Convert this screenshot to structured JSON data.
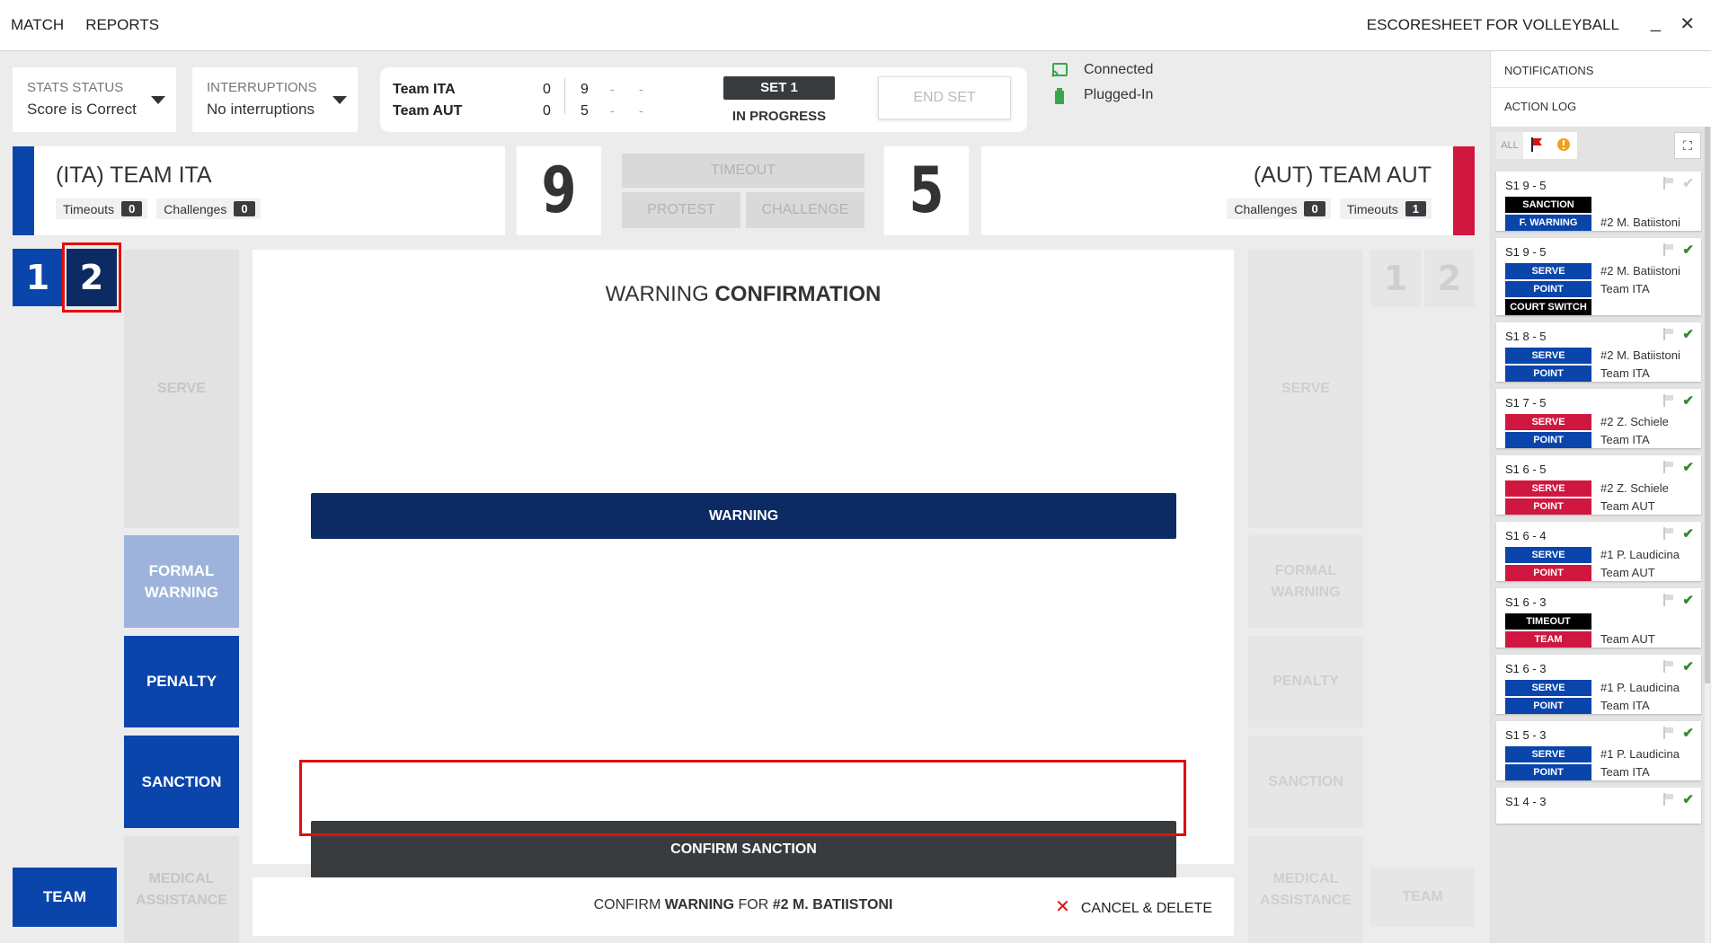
{
  "topbar": {
    "menu": [
      "MATCH",
      "REPORTS"
    ],
    "app_title": "ESCORESHEET FOR VOLLEYBALL",
    "minimize": "_",
    "close": "✕"
  },
  "stats_status": {
    "label": "STATS STATUS",
    "value": "Score is Correct"
  },
  "interruptions": {
    "label": "INTERRUPTIONS",
    "value": "No interruptions"
  },
  "scoreboard": {
    "team1": "Team ITA",
    "team1_sets": "0",
    "team1_points": "9",
    "team2": "Team AUT",
    "team2_sets": "0",
    "team2_points": "5",
    "dash": "-",
    "set_label": "SET 1",
    "set_state": "IN PROGRESS",
    "end_set": "END SET"
  },
  "connection": {
    "status": "Connected",
    "power": "Plugged-In"
  },
  "home": {
    "name": "(ITA) TEAM ITA",
    "timeouts_label": "Timeouts",
    "timeouts": "0",
    "challenges_label": "Challenges",
    "challenges": "0",
    "score": "9",
    "color": "#0a45ab"
  },
  "away": {
    "name": "(AUT) TEAM AUT",
    "timeouts_label": "Timeouts",
    "timeouts": "1",
    "challenges_label": "Challenges",
    "challenges": "0",
    "score": "5",
    "color": "#d0173f"
  },
  "middle_buttons": {
    "timeout": "TIMEOUT",
    "protest": "PROTEST",
    "challenge": "CHALLENGE"
  },
  "sets": {
    "set1": "1",
    "set2": "2"
  },
  "left_actions": {
    "serve": "SERVE",
    "formal_warning": "FORMAL WARNING",
    "penalty": "PENALTY",
    "sanction": "SANCTION",
    "medical": "MEDICAL ASSISTANCE",
    "team": "TEAM"
  },
  "right_actions": {
    "serve": "SERVE",
    "formal_warning": "FORMAL WARNING",
    "penalty": "PENALTY",
    "sanction": "SANCTION",
    "medical": "MEDICAL ASSISTANCE",
    "team": "TEAM",
    "set1": "1",
    "set2": "2"
  },
  "confirmation": {
    "title_plain": "WARNING",
    "title_bold": "CONFIRMATION",
    "option": "WARNING",
    "confirm_button": "CONFIRM SANCTION"
  },
  "bottom": {
    "prefix": "CONFIRM",
    "type": "WARNING",
    "for": "FOR",
    "player": "#2 M. BATIISTONI",
    "cancel": "CANCEL & DELETE"
  },
  "right_panel": {
    "notifications": "NOTIFICATIONS",
    "action_log": "ACTION LOG",
    "filter_all": "ALL",
    "entries": [
      {
        "score": "S1  9 - 5",
        "confirmed": false,
        "rows": [
          {
            "tag": "SANCTION",
            "color": "#000000",
            "text": ""
          },
          {
            "tag": "F. WARNING",
            "color": "#0a45ab",
            "text": "#2 M. Batiistoni"
          }
        ]
      },
      {
        "score": "S1  9 - 5",
        "confirmed": true,
        "rows": [
          {
            "tag": "SERVE",
            "color": "#0a45ab",
            "text": "#2 M. Batiistoni"
          },
          {
            "tag": "POINT",
            "color": "#0a45ab",
            "text": "Team ITA"
          },
          {
            "tag": "COURT SWITCH",
            "color": "#000000",
            "text": ""
          }
        ]
      },
      {
        "score": "S1  8 - 5",
        "confirmed": true,
        "rows": [
          {
            "tag": "SERVE",
            "color": "#0a45ab",
            "text": "#2 M. Batiistoni"
          },
          {
            "tag": "POINT",
            "color": "#0a45ab",
            "text": "Team ITA"
          }
        ]
      },
      {
        "score": "S1  7 - 5",
        "confirmed": true,
        "rows": [
          {
            "tag": "SERVE",
            "color": "#d0173f",
            "text": "#2 Z. Schiele"
          },
          {
            "tag": "POINT",
            "color": "#0a45ab",
            "text": "Team ITA"
          }
        ]
      },
      {
        "score": "S1  6 - 5",
        "confirmed": true,
        "rows": [
          {
            "tag": "SERVE",
            "color": "#d0173f",
            "text": "#2 Z. Schiele"
          },
          {
            "tag": "POINT",
            "color": "#d0173f",
            "text": "Team AUT"
          }
        ]
      },
      {
        "score": "S1  6 - 4",
        "confirmed": true,
        "rows": [
          {
            "tag": "SERVE",
            "color": "#0a45ab",
            "text": "#1 P. Laudicina"
          },
          {
            "tag": "POINT",
            "color": "#d0173f",
            "text": "Team AUT"
          }
        ]
      },
      {
        "score": "S1  6 - 3",
        "confirmed": true,
        "rows": [
          {
            "tag": "TIMEOUT",
            "color": "#000000",
            "text": ""
          },
          {
            "tag": "TEAM",
            "color": "#d0173f",
            "text": "Team AUT"
          }
        ]
      },
      {
        "score": "S1  6 - 3",
        "confirmed": true,
        "rows": [
          {
            "tag": "SERVE",
            "color": "#0a45ab",
            "text": "#1 P. Laudicina"
          },
          {
            "tag": "POINT",
            "color": "#0a45ab",
            "text": "Team ITA"
          }
        ]
      },
      {
        "score": "S1  5 - 3",
        "confirmed": true,
        "rows": [
          {
            "tag": "SERVE",
            "color": "#0a45ab",
            "text": "#1 P. Laudicina"
          },
          {
            "tag": "POINT",
            "color": "#0a45ab",
            "text": "Team ITA"
          }
        ]
      },
      {
        "score": "S1  4 - 3",
        "confirmed": true,
        "rows": []
      }
    ]
  }
}
